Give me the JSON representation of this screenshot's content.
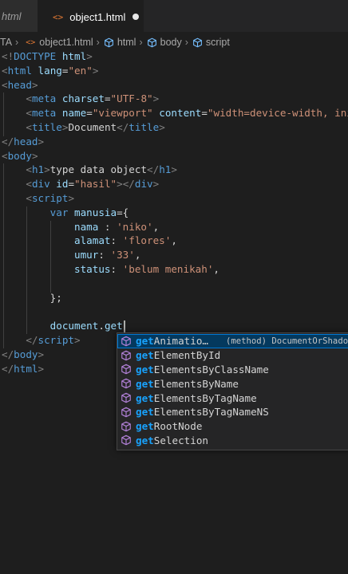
{
  "tabs": [
    {
      "label": "html",
      "active": false
    },
    {
      "label": "object1.html",
      "active": true,
      "modified": true,
      "icon": "html-tag-icon"
    }
  ],
  "breadcrumb": [
    "TA",
    "object1.html",
    "html",
    "body",
    "script"
  ],
  "code_lines": [
    [
      [
        "br",
        "<!"
      ],
      [
        "tag",
        "DOCTYPE"
      ],
      [
        "text",
        " "
      ],
      [
        "attr",
        "html"
      ],
      [
        "br",
        ">"
      ]
    ],
    [
      [
        "br",
        "<"
      ],
      [
        "tag",
        "html"
      ],
      [
        "text",
        " "
      ],
      [
        "attr",
        "lang"
      ],
      [
        "text",
        "="
      ],
      [
        "str",
        "\"en\""
      ],
      [
        "br",
        ">"
      ]
    ],
    [
      [
        "br",
        "<"
      ],
      [
        "tag",
        "head"
      ],
      [
        "br",
        ">"
      ]
    ],
    [
      [
        "text",
        "    "
      ],
      [
        "br",
        "<"
      ],
      [
        "tag",
        "meta"
      ],
      [
        "text",
        " "
      ],
      [
        "attr",
        "charset"
      ],
      [
        "text",
        "="
      ],
      [
        "str",
        "\"UTF-8\""
      ],
      [
        "br",
        ">"
      ]
    ],
    [
      [
        "text",
        "    "
      ],
      [
        "br",
        "<"
      ],
      [
        "tag",
        "meta"
      ],
      [
        "text",
        " "
      ],
      [
        "attr",
        "name"
      ],
      [
        "text",
        "="
      ],
      [
        "str",
        "\"viewport\""
      ],
      [
        "text",
        " "
      ],
      [
        "attr",
        "content"
      ],
      [
        "text",
        "="
      ],
      [
        "str",
        "\"width=device-width, initi"
      ]
    ],
    [
      [
        "text",
        "    "
      ],
      [
        "br",
        "<"
      ],
      [
        "tag",
        "title"
      ],
      [
        "br",
        ">"
      ],
      [
        "text",
        "Document"
      ],
      [
        "br",
        "</"
      ],
      [
        "tag",
        "title"
      ],
      [
        "br",
        ">"
      ]
    ],
    [
      [
        "br",
        "</"
      ],
      [
        "tag",
        "head"
      ],
      [
        "br",
        ">"
      ]
    ],
    [
      [
        "br",
        "<"
      ],
      [
        "tag",
        "body"
      ],
      [
        "br",
        ">"
      ]
    ],
    [
      [
        "text",
        "    "
      ],
      [
        "br",
        "<"
      ],
      [
        "tag",
        "h1"
      ],
      [
        "br",
        ">"
      ],
      [
        "text",
        "type data object"
      ],
      [
        "br",
        "</"
      ],
      [
        "tag",
        "h1"
      ],
      [
        "br",
        ">"
      ]
    ],
    [
      [
        "text",
        "    "
      ],
      [
        "br",
        "<"
      ],
      [
        "tag",
        "div"
      ],
      [
        "text",
        " "
      ],
      [
        "attr",
        "id"
      ],
      [
        "text",
        "="
      ],
      [
        "str",
        "\"hasil\""
      ],
      [
        "br",
        "></"
      ],
      [
        "tag",
        "div"
      ],
      [
        "br",
        ">"
      ]
    ],
    [
      [
        "text",
        "    "
      ],
      [
        "br",
        "<"
      ],
      [
        "tag",
        "script"
      ],
      [
        "br",
        ">"
      ]
    ],
    [
      [
        "text",
        "        "
      ],
      [
        "kw",
        "var"
      ],
      [
        "text",
        " "
      ],
      [
        "var",
        "manusia"
      ],
      [
        "pun",
        "={"
      ]
    ],
    [
      [
        "text",
        "            "
      ],
      [
        "var",
        "nama"
      ],
      [
        "pun",
        " : "
      ],
      [
        "str",
        "'niko'"
      ],
      [
        "pun",
        ","
      ]
    ],
    [
      [
        "text",
        "            "
      ],
      [
        "var",
        "alamat"
      ],
      [
        "pun",
        ": "
      ],
      [
        "str",
        "'flores'"
      ],
      [
        "pun",
        ","
      ]
    ],
    [
      [
        "text",
        "            "
      ],
      [
        "var",
        "umur"
      ],
      [
        "pun",
        ": "
      ],
      [
        "str",
        "'33'"
      ],
      [
        "pun",
        ","
      ]
    ],
    [
      [
        "text",
        "            "
      ],
      [
        "var",
        "status"
      ],
      [
        "pun",
        ": "
      ],
      [
        "str",
        "'belum menikah'"
      ],
      [
        "pun",
        ","
      ]
    ],
    [
      [
        "text",
        ""
      ]
    ],
    [
      [
        "text",
        "        "
      ],
      [
        "pun",
        "};"
      ]
    ],
    [
      [
        "text",
        ""
      ]
    ],
    [
      [
        "text",
        "        "
      ],
      [
        "var",
        "document"
      ],
      [
        "pun",
        "."
      ],
      [
        "var",
        "get"
      ]
    ],
    [
      [
        "text",
        "    "
      ],
      [
        "br",
        "</"
      ],
      [
        "tag",
        "script"
      ],
      [
        "br",
        ">"
      ]
    ],
    [
      [
        "br",
        "</"
      ],
      [
        "tag",
        "body"
      ],
      [
        "br",
        ">"
      ]
    ],
    [
      [
        "br",
        "</"
      ],
      [
        "tag",
        "html"
      ],
      [
        "br",
        ">"
      ]
    ]
  ],
  "suggestions": {
    "typed": "get",
    "items": [
      {
        "match": "get",
        "rest": "Animatio…",
        "detail": "(method) DocumentOrShadowR",
        "selected": true
      },
      {
        "match": "get",
        "rest": "ElementById"
      },
      {
        "match": "get",
        "rest": "ElementsByClassName"
      },
      {
        "match": "get",
        "rest": "ElementsByName"
      },
      {
        "match": "get",
        "rest": "ElementsByTagName"
      },
      {
        "match": "get",
        "rest": "ElementsByTagNameNS"
      },
      {
        "match": "get",
        "rest": "RootNode"
      },
      {
        "match": "get",
        "rest": "Selection"
      }
    ]
  },
  "colors": {
    "editor_bg": "#1e1e1e",
    "tag": "#569cd6",
    "attribute": "#9cdcfe",
    "string": "#ce9178",
    "bracket": "#808080",
    "match_highlight": "#18a3ff",
    "method_icon": "#b180d7",
    "selected_row": "#04395e"
  }
}
